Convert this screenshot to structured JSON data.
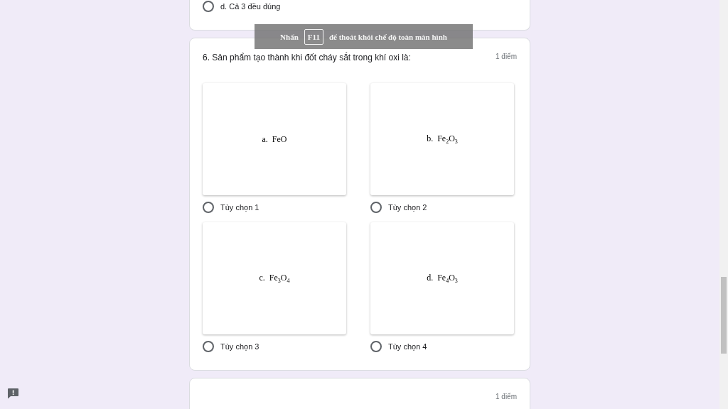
{
  "previous_question": {
    "options": [
      {
        "label": "d. Cả 3 đều đúng",
        "selected": false
      }
    ]
  },
  "question": {
    "title": "6. Sản phẩm tạo thành khi đốt cháy sắt trong khí oxi là:",
    "points": "1 điểm",
    "options": [
      {
        "image_text": "a.  FeO",
        "label": "Tùy chọn 1",
        "selected": false
      },
      {
        "image_text": "b.  Fe$_{2}$O$_{3}$",
        "label": "Tùy chọn 2",
        "selected": false
      },
      {
        "image_text": "c.  Fe$_{3}$O$_{4}$",
        "label": "Tùy chọn 3",
        "selected": false
      },
      {
        "image_text": "d.  Fe$_{4}$O$_{3}$",
        "label": "Tùy chọn 4",
        "selected": false
      }
    ]
  },
  "next_question": {
    "points": "1 điểm"
  },
  "fullscreen_notice": {
    "before": "Nhấn",
    "key": "F11",
    "after": "để thoát khỏi chế độ toàn màn hình"
  }
}
